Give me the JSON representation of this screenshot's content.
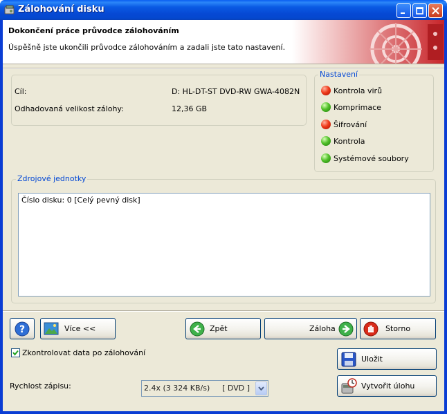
{
  "window": {
    "title": "Zálohování disku"
  },
  "header": {
    "title": "Dokončení práce průvodce zálohováním",
    "subtitle": "Úspěšně jste ukončili průvodce zálohováním a zadali jste tato nastavení."
  },
  "summary": {
    "target_label": "Cíl:",
    "target_value": "D: HL-DT-ST DVD-RW GWA-4082N",
    "size_label": "Odhadovaná velikost zálohy:",
    "size_value": "12,36 GB"
  },
  "settings": {
    "title": "Nastavení",
    "items": [
      {
        "label": "Kontrola virů",
        "status": "off",
        "color": "#e8341a"
      },
      {
        "label": "Komprimace",
        "status": "on",
        "color": "#3fb31f"
      },
      {
        "label": "Šifrování",
        "status": "off",
        "color": "#e8341a"
      },
      {
        "label": "Kontrola",
        "status": "on",
        "color": "#3fb31f"
      },
      {
        "label": "Systémové soubory",
        "status": "on",
        "color": "#3fb31f"
      }
    ]
  },
  "sources": {
    "title": "Zdrojové jednotky",
    "items": [
      "Číslo disku: 0 [Celý pevný disk]"
    ]
  },
  "buttons": {
    "help_icon": "question-icon",
    "more_label": "Více <<",
    "back_label": "Zpět",
    "backup_label": "Záloha",
    "cancel_label": "Storno",
    "save_label": "Uložit",
    "create_task_label": "Vytvořit úlohu"
  },
  "options": {
    "verify_label": "Zkontrolovat data po zálohování",
    "verify_checked": true,
    "speed_label": "Rychlost zápisu:",
    "speed_value": "2.4x (3 324 KB/s)",
    "speed_media": "[ DVD ]"
  }
}
